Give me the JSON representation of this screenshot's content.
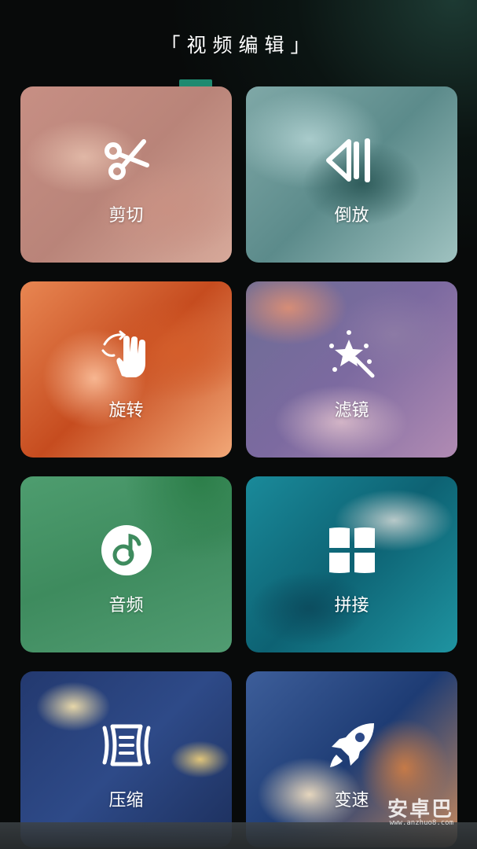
{
  "header": {
    "title": "「视频编辑」"
  },
  "tiles": [
    {
      "label": "剪切",
      "icon": "scissors-icon"
    },
    {
      "label": "倒放",
      "icon": "reverse-play-icon"
    },
    {
      "label": "旋转",
      "icon": "rotate-hand-icon"
    },
    {
      "label": "滤镜",
      "icon": "magic-wand-icon"
    },
    {
      "label": "音频",
      "icon": "music-note-icon"
    },
    {
      "label": "拼接",
      "icon": "splice-grid-icon"
    },
    {
      "label": "压缩",
      "icon": "compress-icon"
    },
    {
      "label": "变速",
      "icon": "rocket-icon"
    }
  ],
  "watermark": {
    "text": "安卓巴",
    "subtext": "www.anzhuo8.com"
  },
  "colors": {
    "accent": "#1f8a70",
    "background": "#080a0a"
  }
}
